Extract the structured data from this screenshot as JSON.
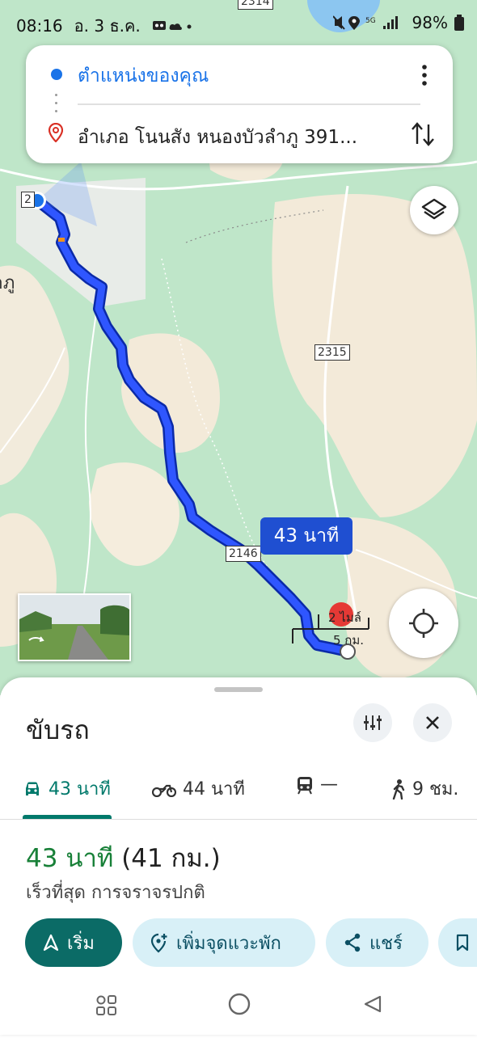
{
  "status_bar": {
    "time": "08:16",
    "date": "อ. 3 ธ.ค.",
    "battery": "98%"
  },
  "search": {
    "origin": "ตำแหน่งของคุณ",
    "destination": "อำเภอ โนนสัง หนองบัวลำภู 391..."
  },
  "map": {
    "route_time_label": "43 นาที",
    "road_labels": [
      "2314",
      "2315",
      "2146",
      "2"
    ],
    "edge_label": "ลำภู",
    "scale": {
      "miles": "2 ไมล์",
      "km": "5 กม."
    }
  },
  "sheet": {
    "title": "ขับรถ",
    "tabs": [
      {
        "label": "43 นาที",
        "icon": "car-icon"
      },
      {
        "label": "44 นาที",
        "icon": "motorcycle-icon"
      },
      {
        "label": "—",
        "icon": "transit-icon"
      },
      {
        "label": "9 ชม.",
        "icon": "walk-icon"
      }
    ],
    "summary": {
      "time": "43 นาที",
      "distance": "(41 กม.)"
    },
    "subtitle": "เร็วที่สุด การจราจรปกติ",
    "actions": {
      "start": "เริ่ม",
      "add_stop": "เพิ่มจุดแวะพัก",
      "share": "แชร์"
    }
  },
  "colors": {
    "route": "#1a3fe0",
    "accent_teal": "#0b6b66",
    "map_green": "#b9e3c4",
    "map_tan": "#f3ead9"
  }
}
